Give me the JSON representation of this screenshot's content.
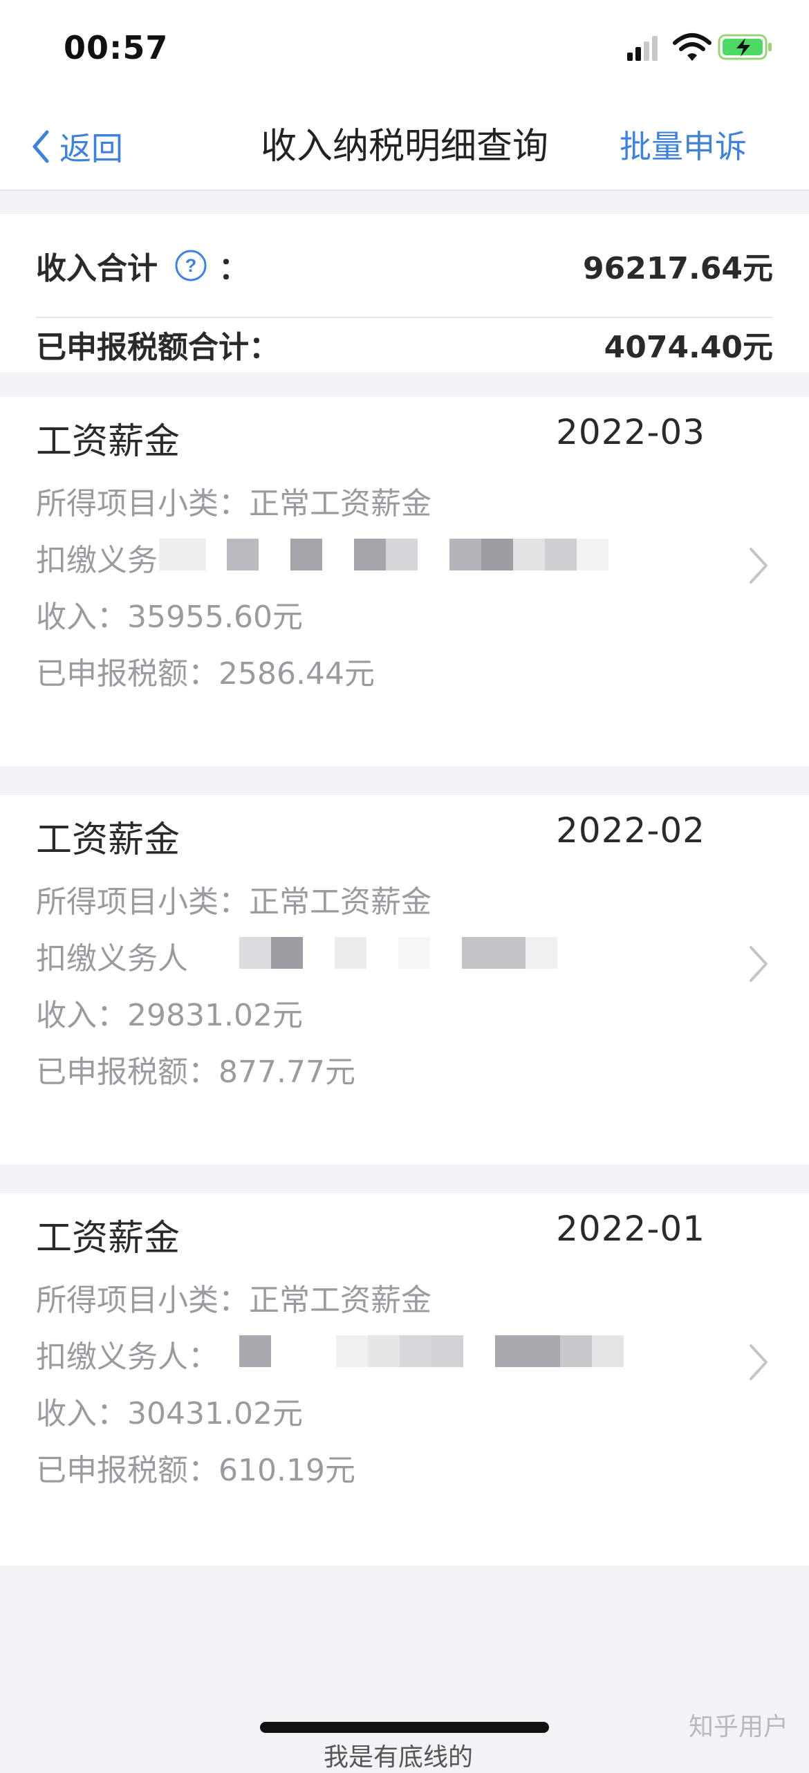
{
  "status_bar": {
    "time": "00:57"
  },
  "nav": {
    "back_label": "返回",
    "title": "收入纳税明细查询",
    "action_label": "批量申诉"
  },
  "summary": {
    "total_income_label": "收入合计",
    "colon": "：",
    "total_income_value": "96217.64元",
    "total_tax_label": "已申报税额合计：",
    "total_tax_value": "4074.40元"
  },
  "records": [
    {
      "title": "工资薪金",
      "date": "2022-03",
      "sub_category": "所得项目小类：正常工资薪金",
      "payer_label": "扣缴义务",
      "income": "收入：35955.60元",
      "tax": "已申报税额：2586.44元"
    },
    {
      "title": "工资薪金",
      "date": "2022-02",
      "sub_category": "所得项目小类：正常工资薪金",
      "payer_label": "扣缴义务人",
      "income": "收入：29831.02元",
      "tax": "已申报税额：877.77元"
    },
    {
      "title": "工资薪金",
      "date": "2022-01",
      "sub_category": "所得项目小类：正常工资薪金",
      "payer_label": "扣缴义务人：",
      "income": "收入：30431.02元",
      "tax": "已申报税额：610.19元"
    }
  ],
  "footer": {
    "watermark": "知乎用户",
    "partial_text": "我是有底线的"
  },
  "colors": {
    "accent": "#3f82d8",
    "background": "#f2f3f7",
    "muted_text": "#9a9ba0"
  },
  "icons": [
    "back-chevron-icon",
    "help-icon",
    "chevron-right-icon",
    "signal-icon",
    "wifi-icon",
    "battery-charging-icon"
  ]
}
